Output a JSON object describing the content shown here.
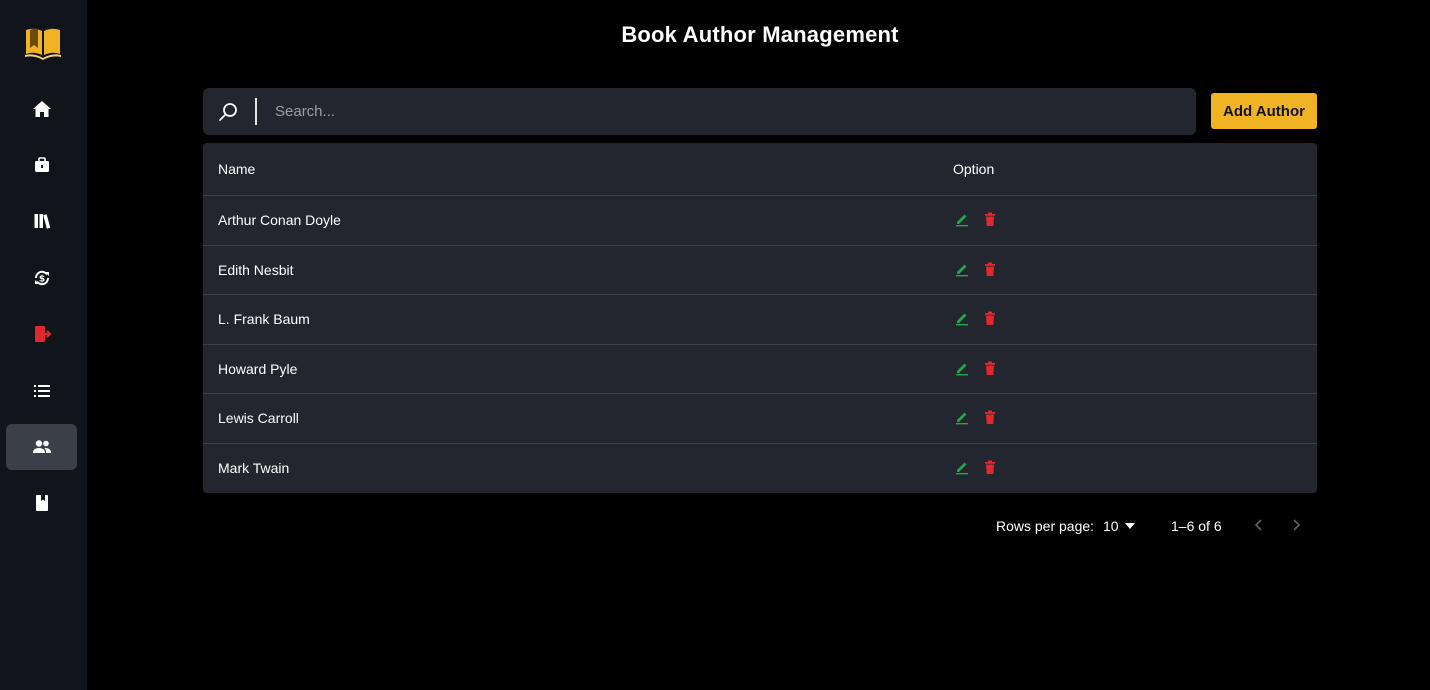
{
  "app": {
    "logo_icon": "open-book-icon",
    "accent_color": "#f0b323"
  },
  "sidebar": {
    "items": [
      {
        "icon": "home-icon",
        "active": false
      },
      {
        "icon": "briefcase-icon",
        "active": false
      },
      {
        "icon": "library-books-icon",
        "active": false
      },
      {
        "icon": "currency-exchange-icon",
        "active": false
      },
      {
        "icon": "exit-icon",
        "active": false
      },
      {
        "icon": "list-icon",
        "active": false
      },
      {
        "icon": "people-icon",
        "active": true
      },
      {
        "icon": "book-icon",
        "active": false
      }
    ]
  },
  "header": {
    "title": "Book Author Management"
  },
  "search": {
    "placeholder": "Search...",
    "value": ""
  },
  "toolbar": {
    "add_label": "Add Author"
  },
  "table": {
    "columns": [
      "Name",
      "Option"
    ],
    "rows": [
      {
        "name": "Arthur Conan Doyle"
      },
      {
        "name": "Edith Nesbit"
      },
      {
        "name": "L. Frank Baum"
      },
      {
        "name": "Howard Pyle"
      },
      {
        "name": "Lewis Carroll"
      },
      {
        "name": "Mark Twain"
      }
    ],
    "edit_color": "#22a84a",
    "delete_color": "#e0282e"
  },
  "pagination": {
    "rows_per_page_label": "Rows per page:",
    "rows_per_page": "10",
    "range": "1–6 of 6"
  }
}
